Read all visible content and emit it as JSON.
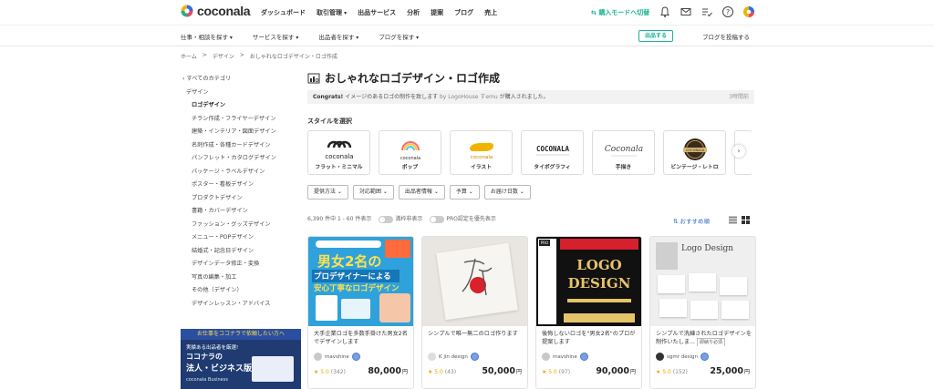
{
  "header": {
    "logo_text": "coconala",
    "nav": [
      {
        "label": "ダッシュボード",
        "dropdown": false
      },
      {
        "label": "取引管理",
        "dropdown": true
      },
      {
        "label": "出品サービス",
        "dropdown": false
      },
      {
        "label": "分析",
        "dropdown": false
      },
      {
        "label": "提案",
        "dropdown": false
      },
      {
        "label": "ブログ",
        "dropdown": false
      },
      {
        "label": "売上",
        "dropdown": false
      }
    ],
    "buyer_mode": "購入モードへ切替",
    "icons": [
      "bell-icon",
      "mail-icon",
      "checklist-icon",
      "help-icon",
      "user-avatar-icon"
    ]
  },
  "subnav": {
    "items": [
      "仕事・相談を探す",
      "サービスを探す",
      "出品者を探す",
      "ブログを探す"
    ],
    "publish": "出品する",
    "post_blog": "ブログを投稿する"
  },
  "breadcrumb": [
    "ホーム",
    ">",
    "デザイン",
    ">",
    "おしゃれなロゴデザイン・ロゴ作成"
  ],
  "sidebar": {
    "all_categories": "‹ すべてのカテゴリ",
    "parent": "デザイン",
    "items": [
      {
        "label": "ロゴデザイン",
        "active": true
      },
      {
        "label": "チラシ作成・フライヤーデザイン"
      },
      {
        "label": "建築・インテリア・図面デザイン"
      },
      {
        "label": "名刺作成・各種カードデザイン"
      },
      {
        "label": "パンフレット・カタログデザイン"
      },
      {
        "label": "パッケージ・ラベルデザイン"
      },
      {
        "label": "ポスター・看板デザイン"
      },
      {
        "label": "プロダクトデザイン"
      },
      {
        "label": "書籍・カバーデザイン"
      },
      {
        "label": "ファッション・グッズデザイン"
      },
      {
        "label": "メニュー・POPデザイン"
      },
      {
        "label": "結婚式・記念日デザイン"
      },
      {
        "label": "デザインデータ修正・変換"
      },
      {
        "label": "写真の編集・加工"
      },
      {
        "label": "その他（デザイン）"
      },
      {
        "label": "デザインレッスン・アドバイス"
      }
    ],
    "banner": {
      "line1": "お仕事をココナラで依頼したい方へ",
      "line2": "実績ある出品者を厳選!",
      "line3": "ココナラの",
      "line4": "法人・ビジネス版",
      "line5": "coconala Business"
    }
  },
  "main": {
    "title": "おしゃれなロゴデザイン・ロゴ作成",
    "notice": {
      "prefix": "Congrats!",
      "text": " イメージのあるロゴの制作を致します",
      "by": " by LogoHouse すemu",
      "suffix": " が購入されました。",
      "time": "3時間前"
    },
    "style_heading": "スタイルを選択",
    "styles": [
      {
        "label": "フラット・ミニマル",
        "art": "coconala"
      },
      {
        "label": "ポップ",
        "art": "coconala"
      },
      {
        "label": "イラスト",
        "art": "coconala"
      },
      {
        "label": "タイポグラフィ",
        "art": "COCONALA"
      },
      {
        "label": "手描き",
        "art": "Coconala"
      },
      {
        "label": "ビンテージ・レトロ",
        "art": "COCONALA"
      }
    ],
    "filters": [
      "提供方法",
      "対応範囲",
      "出品者情報",
      "予算",
      "お届け日数"
    ],
    "count_text": "6,390 件中 1 - 60 件表示",
    "toggle1": "満枠非表示",
    "toggle2": "PRO認定を優先表示",
    "sort": "おすすめ順",
    "products": [
      {
        "title": "大手企業ロゴを多数手掛けた男女2名でデザインします",
        "seller": "mavshine",
        "rating": "5.0",
        "reviews": "(342)",
        "price": "80,000",
        "thumb_text": [
          "男女2名の",
          "プロデザイナーによる",
          "安心丁寧なロゴデザイン"
        ]
      },
      {
        "title": "シンプルで唯一無二のロゴ作ります",
        "seller": "K jin design",
        "rating": "5.0",
        "reviews": "(43)",
        "price": "50,000"
      },
      {
        "title": "後悔しないロゴを\"男女2名\"のプロが提案します",
        "seller": "mavshine",
        "rating": "5.0",
        "reviews": "(97)",
        "price": "90,000",
        "thumb_text": [
          "LOGO",
          "DESIGN"
        ]
      },
      {
        "title": "シンプルで洗練されたロゴデザインを制作いたしま...",
        "seller": "sgmr design",
        "rating": "5.0",
        "reviews": "(152)",
        "price": "25,000",
        "tag": "即納り必須",
        "thumb_text": [
          "Logo Design"
        ]
      }
    ],
    "currency": "円"
  }
}
